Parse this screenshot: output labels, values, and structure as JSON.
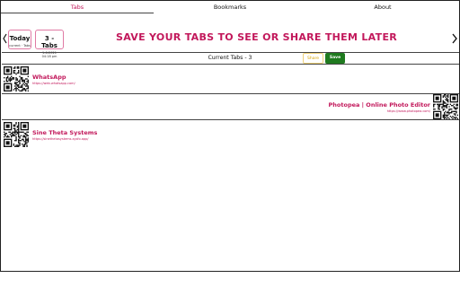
{
  "tabs": [
    {
      "label": "Tabs",
      "active": true
    },
    {
      "label": "Bookmarks",
      "active": false
    },
    {
      "label": "About",
      "active": false
    }
  ],
  "sessions": [
    {
      "title": "Today",
      "subtitle": "current · Tabs"
    },
    {
      "title": "3 - Tabs",
      "line1": "1-6-2021",
      "line2": "04:18 pm"
    }
  ],
  "headline": "SAVE YOUR TABS TO SEE OR SHARE THEM LATER",
  "current_label": "Current Tabs - 3",
  "buttons": {
    "share": "Share",
    "save": "Save"
  },
  "entries": [
    {
      "title": "WhatsApp",
      "url": "https://web.whatsapp.com/"
    },
    {
      "title": "Photopea | Online Photo Editor",
      "url": "https://www.photopea.com/"
    },
    {
      "title": "Sine Theta Systems",
      "url": "https://sinethetasystems.sysfo.app/"
    }
  ],
  "colors": {
    "accent": "#c2185b",
    "save": "#1f7a1f",
    "share": "#d8a400"
  }
}
